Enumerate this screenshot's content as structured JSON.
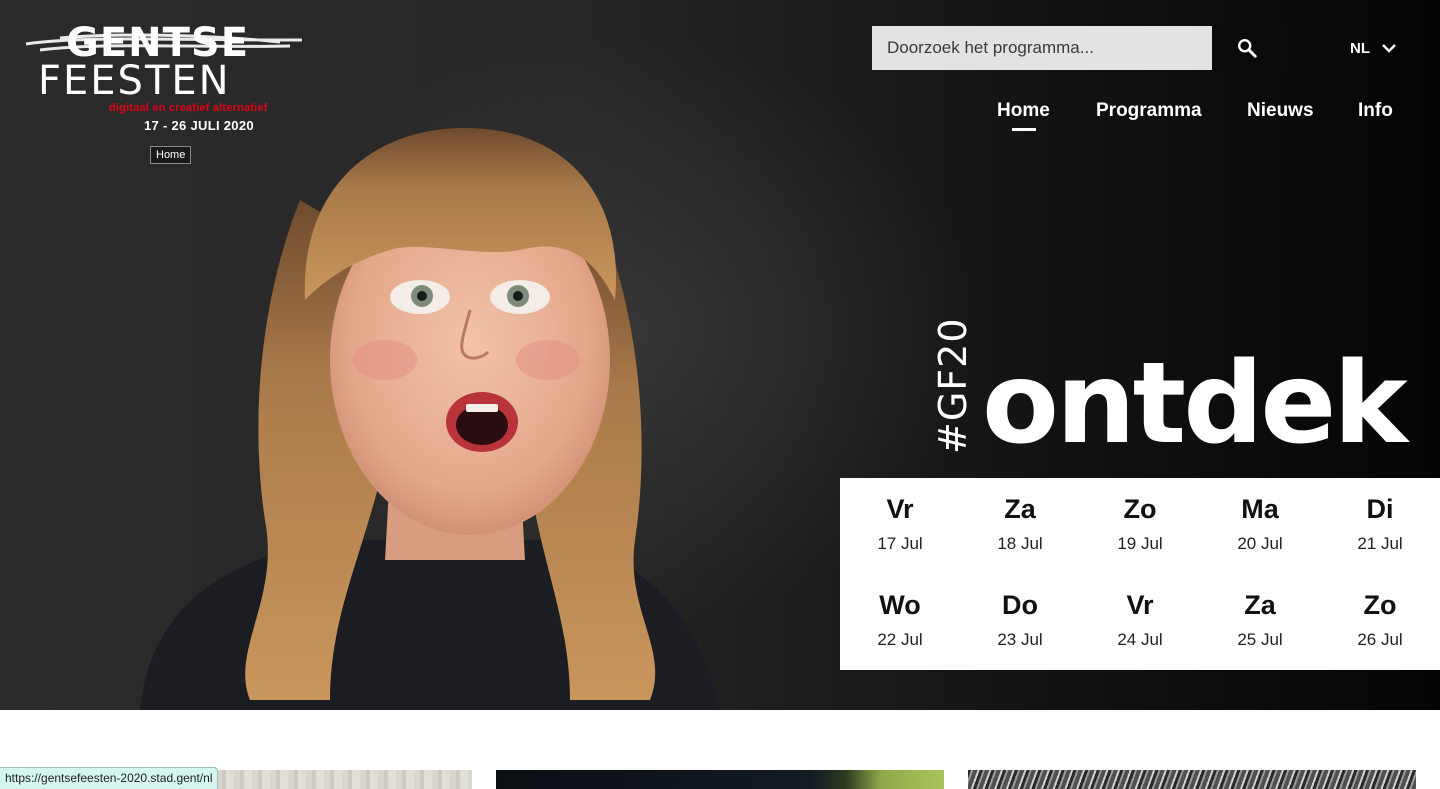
{
  "logo": {
    "line1": "GENTSE",
    "line2": "FEESTEN",
    "tagline": "digitaal en creatief alternatief",
    "dates": "17 - 26 JULI 2020"
  },
  "tooltip": "Home",
  "search": {
    "placeholder": "Doorzoek het programma...",
    "icon": "search-icon"
  },
  "language": {
    "current": "NL",
    "icon": "chevron-down-icon"
  },
  "nav": {
    "items": [
      {
        "label": "Home",
        "active": true
      },
      {
        "label": "Programma",
        "active": false
      },
      {
        "label": "Nieuws",
        "active": false
      },
      {
        "label": "Info",
        "active": false
      }
    ]
  },
  "hero": {
    "hashtag": "#GF20",
    "headline": "ontdek"
  },
  "calendar": [
    {
      "day": "Vr",
      "date": "17 Jul"
    },
    {
      "day": "Za",
      "date": "18 Jul"
    },
    {
      "day": "Zo",
      "date": "19 Jul"
    },
    {
      "day": "Ma",
      "date": "20 Jul"
    },
    {
      "day": "Di",
      "date": "21 Jul"
    },
    {
      "day": "Wo",
      "date": "22 Jul"
    },
    {
      "day": "Do",
      "date": "23 Jul"
    },
    {
      "day": "Vr",
      "date": "24 Jul"
    },
    {
      "day": "Za",
      "date": "25 Jul"
    },
    {
      "day": "Zo",
      "date": "26 Jul"
    }
  ],
  "statusbar": "https://gentsefeesten-2020.stad.gent/nl",
  "colors": {
    "accent_red": "#e2001a",
    "hero_bg": "#1c1c1c",
    "search_bg": "#e3e3e3"
  }
}
